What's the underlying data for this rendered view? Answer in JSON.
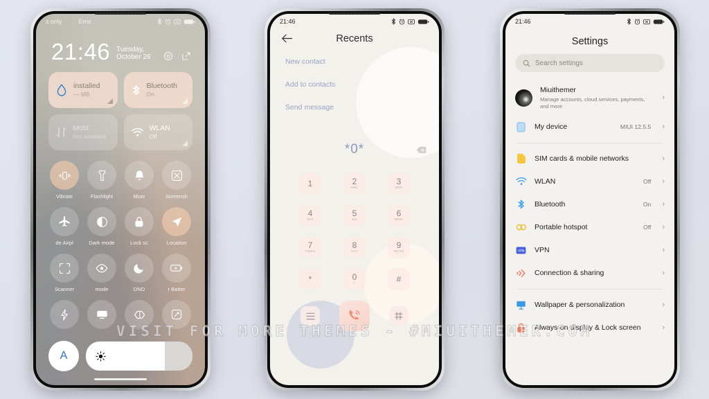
{
  "watermark": "VISIT FOR MORE THEMES - #MIUITHEMER.COM",
  "phone1": {
    "statusbar": {
      "left1": "s only",
      "left2": "Eme",
      "icons": [
        "bluetooth-icon",
        "alarm-icon",
        "dnd-icon",
        "battery-icon"
      ]
    },
    "clock": {
      "time": "21:46",
      "date": "Tuesday, October 26"
    },
    "actions": [
      "settings-gear-icon",
      "edit-icon"
    ],
    "big_tiles": [
      {
        "title": "installed",
        "sub": "— MB",
        "icon": "water-drop-icon",
        "state": "on"
      },
      {
        "title": "Bluetooth",
        "sub": "On",
        "icon": "bluetooth-icon",
        "state": "on"
      },
      {
        "title": "Mobi",
        "sub": "Not available",
        "icon": "mobile-data-icon",
        "state": "off"
      },
      {
        "title": "WLAN",
        "sub": "Off",
        "icon": "wifi-icon",
        "state": "off"
      }
    ],
    "tiles": [
      {
        "label": "Vibrate",
        "icon": "vibrate-icon",
        "accent": true
      },
      {
        "label": "Flashlight",
        "icon": "flashlight-icon",
        "accent": false
      },
      {
        "label": "Mute",
        "icon": "bell-icon",
        "accent": false
      },
      {
        "label": "Screensh",
        "icon": "screenshot-icon",
        "accent": false
      },
      {
        "label": "de  Airpl",
        "icon": "airplane-icon",
        "accent": false
      },
      {
        "label": "Dark mode",
        "icon": "dark-mode-icon",
        "accent": false
      },
      {
        "label": "Lock sc",
        "icon": "lock-icon",
        "accent": false
      },
      {
        "label": "Location",
        "icon": "location-icon",
        "accent": true
      },
      {
        "label": "Scanner",
        "icon": "scanner-icon",
        "accent": false
      },
      {
        "label": "mode",
        "icon": "eye-icon",
        "accent": false
      },
      {
        "label": "DND",
        "icon": "moon-icon",
        "accent": false
      },
      {
        "label": "r  Batter",
        "icon": "battery-saver-icon",
        "accent": false
      },
      {
        "label": "",
        "icon": "lightning-icon",
        "accent": false
      },
      {
        "label": "",
        "icon": "cast-icon",
        "accent": false
      },
      {
        "label": "",
        "icon": "nfc-icon",
        "accent": false
      },
      {
        "label": "",
        "icon": "rotate-icon",
        "accent": false
      }
    ],
    "brightness": {
      "auto_label": "A",
      "icon": "brightness-icon",
      "level": 74
    }
  },
  "phone2": {
    "statusbar": {
      "time": "21:46",
      "icons": [
        "bluetooth-icon",
        "alarm-icon",
        "dnd-icon",
        "battery-icon"
      ]
    },
    "title": "Recents",
    "back_icon": "back-arrow-icon",
    "menu": [
      "New contact",
      "Add to contacts",
      "Send message"
    ],
    "display": {
      "number": "*0*",
      "backspace_icon": "backspace-icon"
    },
    "keys": [
      {
        "n": "1",
        "l": ""
      },
      {
        "n": "2",
        "l": "ABC"
      },
      {
        "n": "3",
        "l": "DEF"
      },
      {
        "n": "4",
        "l": "GHI"
      },
      {
        "n": "5",
        "l": "JKL"
      },
      {
        "n": "6",
        "l": "MNO"
      },
      {
        "n": "7",
        "l": "PQRS"
      },
      {
        "n": "8",
        "l": "TUV"
      },
      {
        "n": "9",
        "l": "WXYZ"
      },
      {
        "n": "*",
        "l": ""
      },
      {
        "n": "0",
        "l": "+"
      },
      {
        "n": "#",
        "l": ""
      }
    ],
    "actions": {
      "left_icon": "menu-list-icon",
      "call_icon": "call-icon",
      "right_icon": "keypad-icon"
    }
  },
  "phone3": {
    "statusbar": {
      "time": "21:46",
      "icons": [
        "bluetooth-icon",
        "alarm-icon",
        "dnd-icon",
        "battery-icon"
      ]
    },
    "title": "Settings",
    "search": {
      "placeholder": "Search settings",
      "icon": "search-icon"
    },
    "account": {
      "name": "Miuithemer",
      "desc": "Manage accounts, cloud services, payments, and more"
    },
    "rows": [
      {
        "label": "My device",
        "value": "MIUI 12.5.5",
        "icon": "device-icon"
      },
      {
        "label": "SIM cards & mobile networks",
        "value": "",
        "icon": "sim-icon"
      },
      {
        "label": "WLAN",
        "value": "Off",
        "icon": "wifi-icon"
      },
      {
        "label": "Bluetooth",
        "value": "On",
        "icon": "bluetooth-icon"
      },
      {
        "label": "Portable hotspot",
        "value": "Off",
        "icon": "hotspot-icon"
      },
      {
        "label": "VPN",
        "value": "",
        "icon": "vpn-icon"
      },
      {
        "label": "Connection & sharing",
        "value": "",
        "icon": "connection-sharing-icon"
      },
      {
        "label": "Wallpaper & personalization",
        "value": "",
        "icon": "wallpaper-icon"
      },
      {
        "label": "Always-on display & Lock screen",
        "value": "",
        "icon": "lock-screen-icon"
      }
    ]
  },
  "colors": {
    "accent_blue": "#2f6fd0",
    "tile_cream": "#f0dacd",
    "settings_bg": "#f4f2ee",
    "dialer_bg": "#f3f1ec"
  }
}
